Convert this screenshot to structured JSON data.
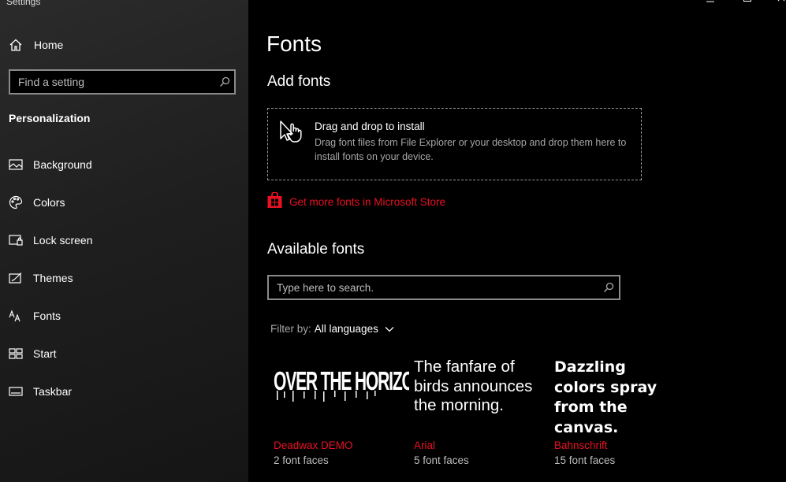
{
  "window": {
    "title": "Settings"
  },
  "sidebar": {
    "home_label": "Home",
    "search_placeholder": "Find a setting",
    "section_heading": "Personalization",
    "items": [
      {
        "label": "Background",
        "icon": "picture-icon"
      },
      {
        "label": "Colors",
        "icon": "palette-icon"
      },
      {
        "label": "Lock screen",
        "icon": "lock-screen-icon"
      },
      {
        "label": "Themes",
        "icon": "themes-icon"
      },
      {
        "label": "Fonts",
        "icon": "fonts-icon"
      },
      {
        "label": "Start",
        "icon": "start-icon"
      },
      {
        "label": "Taskbar",
        "icon": "taskbar-icon"
      }
    ]
  },
  "main": {
    "title": "Fonts",
    "add_fonts": {
      "heading": "Add fonts",
      "drop_title": "Drag and drop to install",
      "drop_description": "Drag font files from File Explorer or your desktop and drop them here to install fonts on your device.",
      "store_link": "Get more fonts in Microsoft Store"
    },
    "available": {
      "heading": "Available fonts",
      "search_placeholder": "Type here to search.",
      "filter_prefix": "Filter by:",
      "filter_value": "All languages",
      "fonts": [
        {
          "preview": "OVER THE HORIZO...",
          "name": "Deadwax DEMO",
          "faces": "2 font faces"
        },
        {
          "preview": "The fanfare of birds announces the morning.",
          "name": "Arial",
          "faces": "5 font faces"
        },
        {
          "preview": "Dazzling colors spray from the canvas.",
          "name": "Bahnschrift",
          "faces": "15 font faces"
        }
      ]
    }
  },
  "colors": {
    "accent": "#e81123",
    "sidebar_bg": "#1f1f1f",
    "main_bg": "#000000",
    "secondary_text": "#a6a6a6"
  }
}
